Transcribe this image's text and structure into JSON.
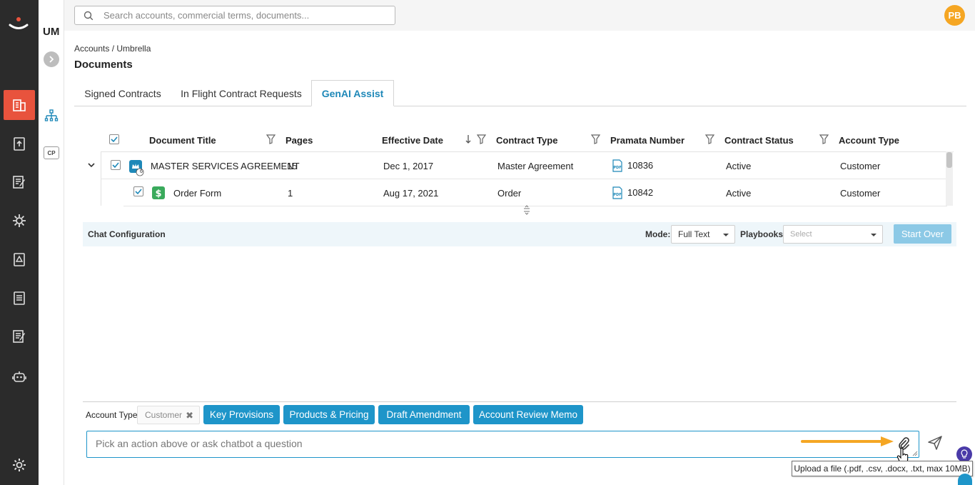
{
  "side2": {
    "title": "UM",
    "cp_label": "CP"
  },
  "topbar": {
    "search_placeholder": "Search accounts, commercial terms, documents...",
    "avatar_initials": "PB"
  },
  "breadcrumb": "Accounts / Umbrella",
  "page_title": "Documents",
  "tabs": [
    {
      "label": "Signed Contracts"
    },
    {
      "label": "In Flight Contract Requests"
    },
    {
      "label": "GenAI Assist",
      "active": true
    }
  ],
  "table": {
    "columns": [
      "Document Title",
      "Pages",
      "Effective Date",
      "Contract Type",
      "Pramata Number",
      "Contract Status",
      "Account Type"
    ],
    "rows": [
      {
        "title": "MASTER SERVICES AGREEMENT",
        "badge": "6",
        "pages": "15",
        "effective_date": "Dec 1, 2017",
        "contract_type": "Master Agreement",
        "pramata_number": "10836",
        "status": "Active",
        "account_type": "Customer"
      },
      {
        "title": "Order Form",
        "pages": "1",
        "effective_date": "Aug 17, 2021",
        "contract_type": "Order",
        "pramata_number": "10842",
        "status": "Active",
        "account_type": "Customer"
      }
    ]
  },
  "chat_config": {
    "title": "Chat Configuration",
    "mode_label": "Mode:",
    "mode_value": "Full Text",
    "playbooks_label": "Playbooks:",
    "playbooks_placeholder": "Select",
    "start_over_label": "Start Over"
  },
  "actions": {
    "account_type_label": "Account Type",
    "account_type_chip": "Customer",
    "buttons": [
      "Key Provisions",
      "Products & Pricing",
      "Draft Amendment",
      "Account Review Memo"
    ]
  },
  "chat": {
    "input_placeholder": "Pick an action above or ask chatbot a question",
    "upload_tooltip": "Upload a file (.pdf, .csv, .docx, .txt, max 10MB)"
  },
  "colors": {
    "accent": "#1e95c9",
    "rail_active": "#e8533d",
    "avatar": "#f5a623",
    "arrow": "#f5a623"
  }
}
